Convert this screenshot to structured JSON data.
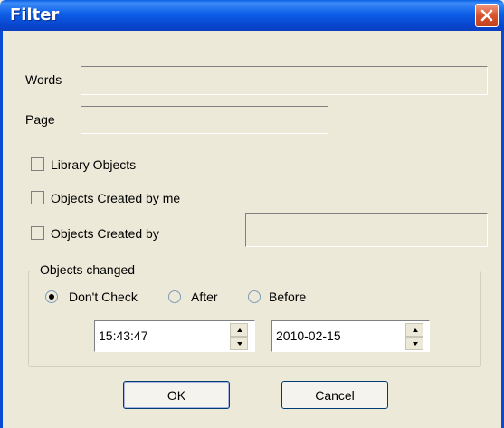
{
  "window": {
    "title": "Filter"
  },
  "fields": {
    "words_label": "Words",
    "words_value": "",
    "page_label": "Page",
    "page_value": ""
  },
  "checkboxes": [
    {
      "label": "Library Objects",
      "checked": false
    },
    {
      "label": "Objects Created by me",
      "checked": false
    },
    {
      "label": "Objects Created by",
      "checked": false
    }
  ],
  "created_by_value": "",
  "objects_changed": {
    "title": "Objects changed",
    "options": [
      "Don't Check",
      "After",
      "Before"
    ],
    "selected": "Don't Check",
    "time": "15:43:47",
    "date": "2010-02-15"
  },
  "buttons": {
    "ok": "OK",
    "cancel": "Cancel"
  },
  "icons": {
    "close": "close-icon",
    "spin_up": "arrow-up-icon",
    "spin_down": "arrow-down-icon"
  },
  "colors": {
    "titlebar": "#0a5fe3",
    "close_button": "#d9532e",
    "background": "#ece9d8"
  }
}
